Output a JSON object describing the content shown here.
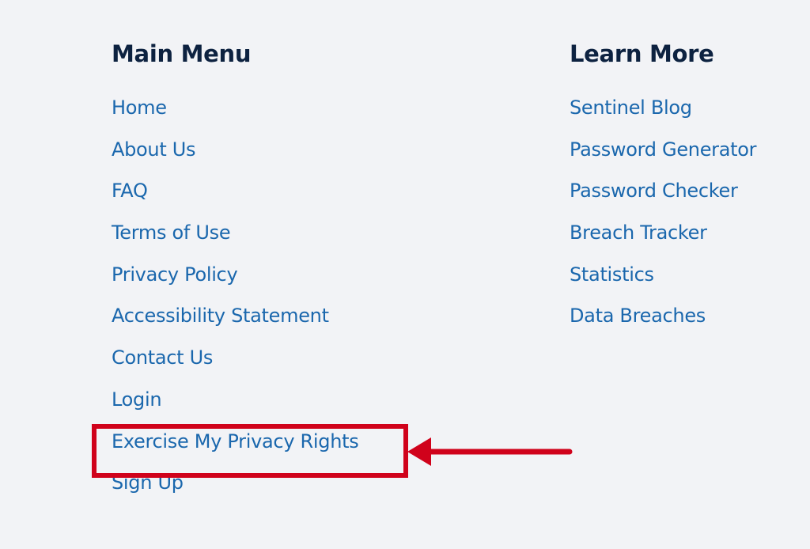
{
  "main_menu": {
    "heading": "Main Menu",
    "items": [
      "Home",
      "About Us",
      "FAQ",
      "Terms of Use",
      "Privacy Policy",
      "Accessibility Statement",
      "Contact Us",
      "Login",
      "Exercise My Privacy Rights",
      "Sign Up"
    ]
  },
  "learn_more": {
    "heading": "Learn More",
    "items": [
      "Sentinel Blog",
      "Password Generator",
      "Password Checker",
      "Breach Tracker",
      "Statistics",
      "Data Breaches"
    ]
  },
  "annotation": {
    "color": "#d0021b",
    "highlighted_item": "Exercise My Privacy Rights"
  }
}
